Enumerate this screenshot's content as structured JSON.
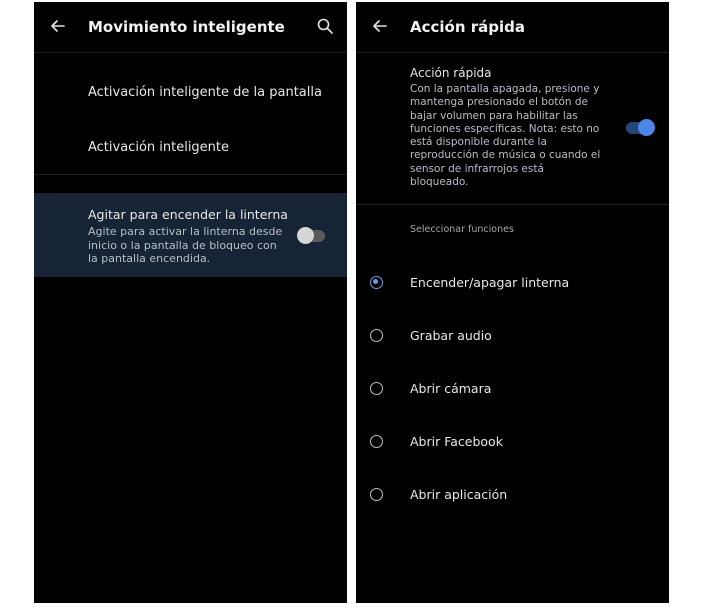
{
  "left_screen": {
    "title": "Movimiento inteligente",
    "items": [
      {
        "label": "Activación inteligente de la pantalla"
      },
      {
        "label": "Activación inteligente"
      }
    ],
    "shake": {
      "title": "Agitar para encender la linterna",
      "subtitle": "Agite para activar la linterna desde inicio o la pantalla de bloqueo con la pantalla encendida.",
      "enabled": false
    },
    "icons": {
      "back": "back-arrow-icon",
      "search": "search-icon"
    }
  },
  "right_screen": {
    "title": "Acción rápida",
    "quick_action": {
      "title": "Acción rápida",
      "description": "Con la pantalla apagada, presione y mantenga presionado el botón de bajar volumen para habilitar las funciones específicas. Nota: esto no está disponible durante la reproducción de música o cuando el sensor de infrarrojos está bloqueado.",
      "enabled": true
    },
    "section_label": "Seleccionar funciones",
    "options": [
      {
        "label": "Encender/apagar linterna",
        "selected": true
      },
      {
        "label": "Grabar audio",
        "selected": false
      },
      {
        "label": "Abrir cámara",
        "selected": false
      },
      {
        "label": "Abrir Facebook",
        "selected": false
      },
      {
        "label": "Abrir aplicación",
        "selected": false
      }
    ],
    "icons": {
      "back": "back-arrow-icon"
    }
  },
  "colors": {
    "accent": "#4b86e6",
    "highlight": "#162436",
    "background": "#000000"
  }
}
